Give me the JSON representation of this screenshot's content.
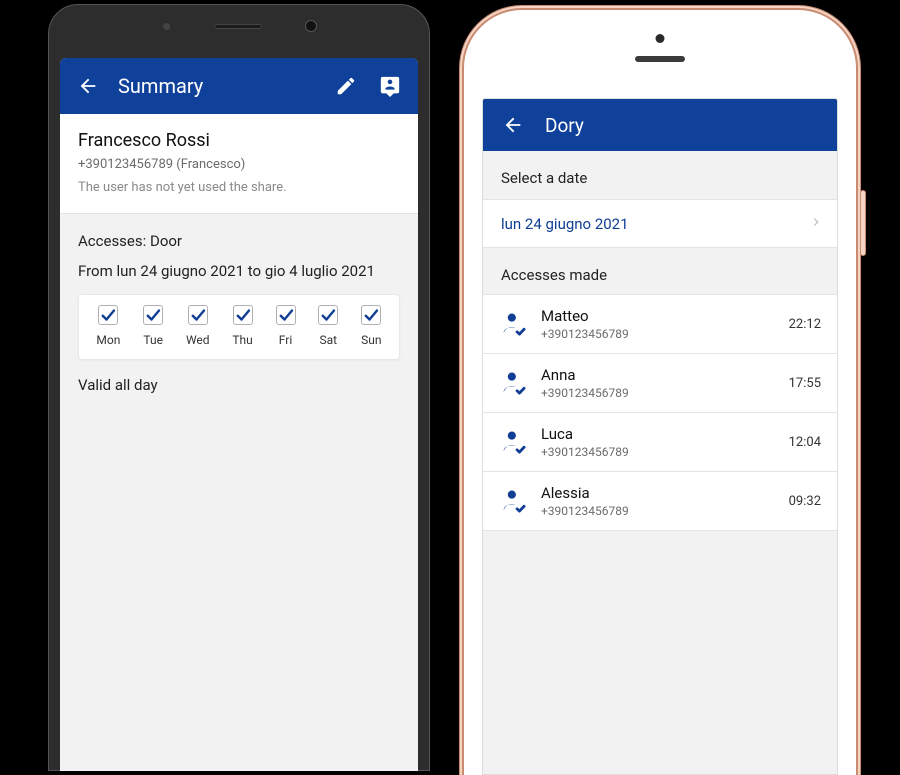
{
  "left": {
    "appbar": {
      "title": "Summary"
    },
    "user": {
      "name": "Francesco Rossi",
      "phone": "+390123456789",
      "contact": "(Francesco)",
      "note": "The user has not yet used the share."
    },
    "accesses": {
      "label": "Accesses: Door",
      "range_prefix": "From",
      "range_from": "lun 24 giugno 2021",
      "range_mid": "to",
      "range_to": "gio 4 luglio 2021"
    },
    "days": [
      {
        "label": "Mon",
        "checked": true
      },
      {
        "label": "Tue",
        "checked": true
      },
      {
        "label": "Wed",
        "checked": true
      },
      {
        "label": "Thu",
        "checked": true
      },
      {
        "label": "Fri",
        "checked": true
      },
      {
        "label": "Sat",
        "checked": true
      },
      {
        "label": "Sun",
        "checked": true
      }
    ],
    "validity": "Valid all day"
  },
  "right": {
    "appbar": {
      "title": "Dory"
    },
    "select_label": "Select a date",
    "selected_date": "lun 24 giugno 2021",
    "list_label": "Accesses made",
    "accesses": [
      {
        "name": "Matteo",
        "phone": "+390123456789",
        "time": "22:12"
      },
      {
        "name": "Anna",
        "phone": "+390123456789",
        "time": "17:55"
      },
      {
        "name": "Luca",
        "phone": "+390123456789",
        "time": "12:04"
      },
      {
        "name": "Alessia",
        "phone": "+390123456789",
        "time": "09:32"
      }
    ]
  }
}
